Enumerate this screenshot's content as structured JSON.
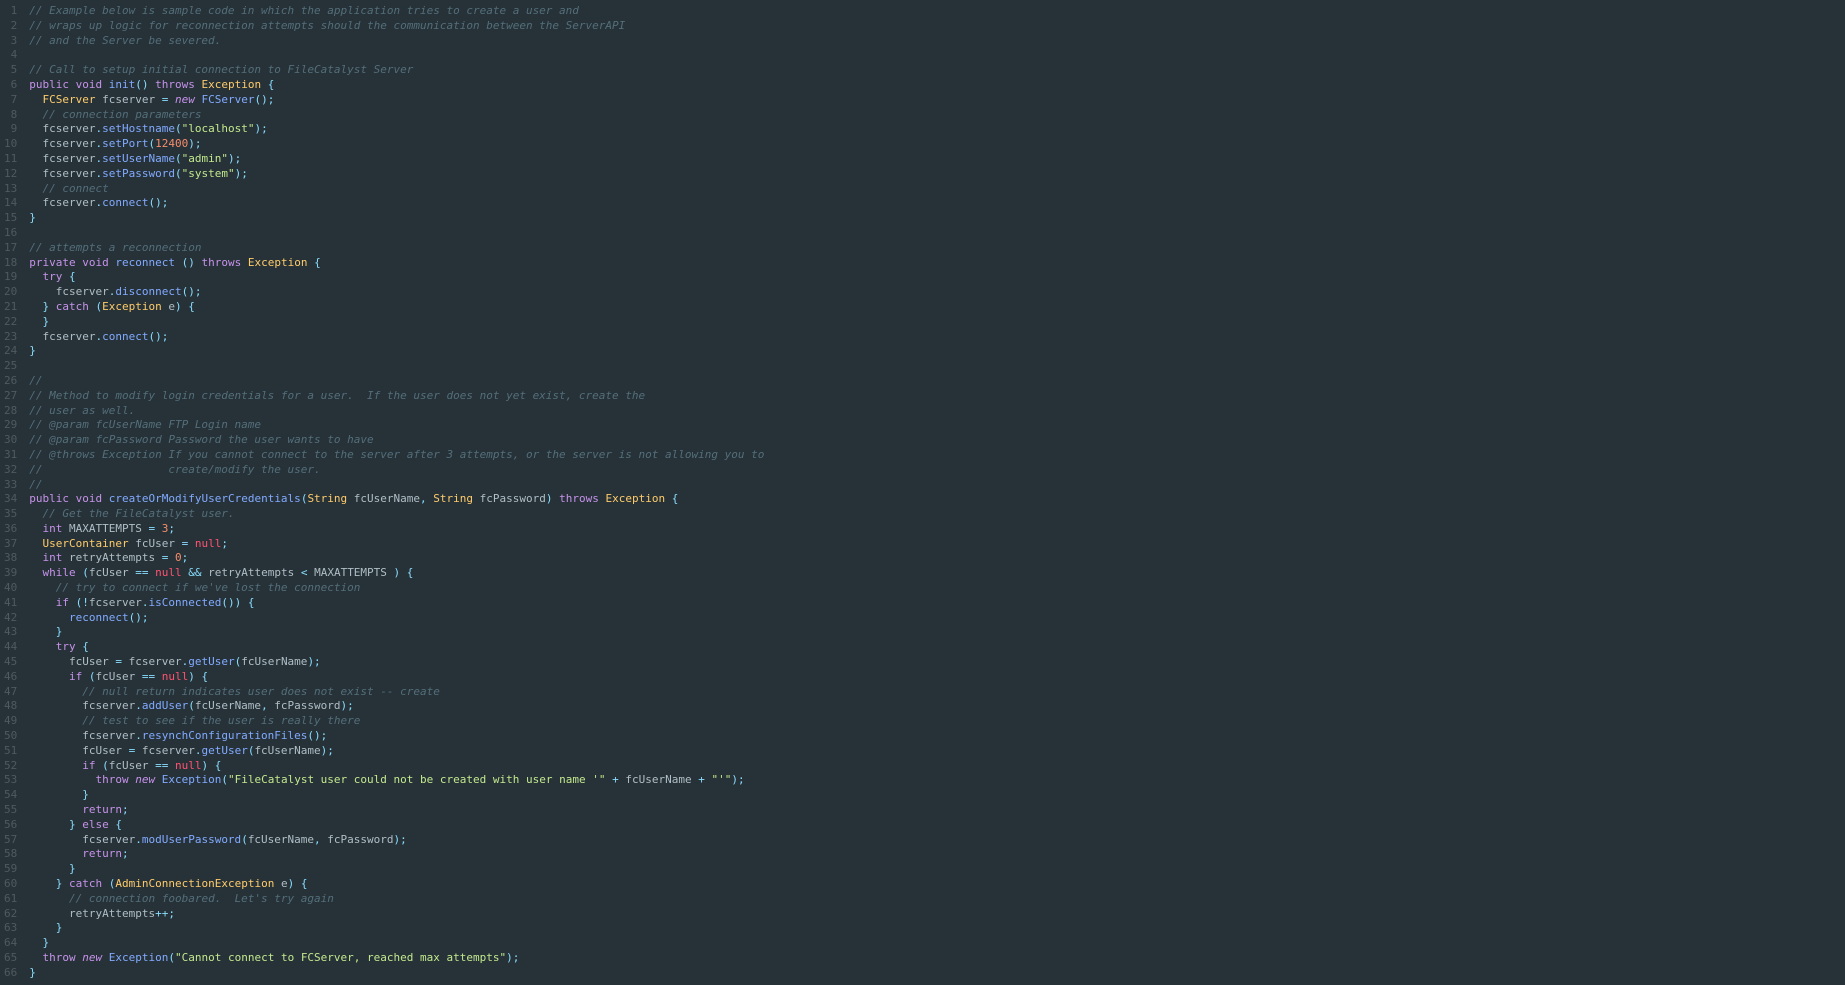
{
  "lines": [
    [
      [
        0,
        "cmt",
        "// Example below is sample code in which the application tries to create a user and "
      ]
    ],
    [
      [
        0,
        "cmt",
        "// wraps up logic for reconnection attempts should the communication between the ServerAPI "
      ]
    ],
    [
      [
        0,
        "cmt",
        "// and the Server be severed."
      ]
    ],
    [
      [
        0,
        "pl",
        ""
      ]
    ],
    [
      [
        0,
        "cmt",
        "// Call to setup initial connection to FileCatalyst Server"
      ]
    ],
    [
      [
        0,
        "kw",
        "public"
      ],
      [
        0,
        "pl",
        " "
      ],
      [
        0,
        "kw",
        "void"
      ],
      [
        0,
        "pl",
        " "
      ],
      [
        0,
        "fn",
        "init"
      ],
      [
        0,
        "op",
        "()"
      ],
      [
        0,
        "pl",
        " "
      ],
      [
        0,
        "kw",
        "throws"
      ],
      [
        0,
        "pl",
        " "
      ],
      [
        0,
        "ty",
        "Exception"
      ],
      [
        0,
        "pl",
        " "
      ],
      [
        0,
        "op",
        "{"
      ]
    ],
    [
      [
        1,
        "ty",
        "FCServer"
      ],
      [
        0,
        "pl",
        " fcserver "
      ],
      [
        0,
        "op",
        "="
      ],
      [
        0,
        "pl",
        " "
      ],
      [
        0,
        "kw2",
        "new"
      ],
      [
        0,
        "pl",
        " "
      ],
      [
        0,
        "fn",
        "FCServer"
      ],
      [
        0,
        "op",
        "();"
      ]
    ],
    [
      [
        1,
        "cmt",
        "// connection parameters"
      ]
    ],
    [
      [
        1,
        "pl",
        "fcserver"
      ],
      [
        0,
        "op",
        "."
      ],
      [
        0,
        "fn",
        "setHostname"
      ],
      [
        0,
        "op",
        "("
      ],
      [
        0,
        "str",
        "\"localhost\""
      ],
      [
        0,
        "op",
        ");"
      ]
    ],
    [
      [
        1,
        "pl",
        "fcserver"
      ],
      [
        0,
        "op",
        "."
      ],
      [
        0,
        "fn",
        "setPort"
      ],
      [
        0,
        "op",
        "("
      ],
      [
        0,
        "num",
        "12400"
      ],
      [
        0,
        "op",
        ");"
      ]
    ],
    [
      [
        1,
        "pl",
        "fcserver"
      ],
      [
        0,
        "op",
        "."
      ],
      [
        0,
        "fn",
        "setUserName"
      ],
      [
        0,
        "op",
        "("
      ],
      [
        0,
        "str",
        "\"admin\""
      ],
      [
        0,
        "op",
        ");"
      ]
    ],
    [
      [
        1,
        "pl",
        "fcserver"
      ],
      [
        0,
        "op",
        "."
      ],
      [
        0,
        "fn",
        "setPassword"
      ],
      [
        0,
        "op",
        "("
      ],
      [
        0,
        "str",
        "\"system\""
      ],
      [
        0,
        "op",
        ");"
      ]
    ],
    [
      [
        1,
        "cmt",
        "// connect"
      ]
    ],
    [
      [
        1,
        "pl",
        "fcserver"
      ],
      [
        0,
        "op",
        "."
      ],
      [
        0,
        "fn",
        "connect"
      ],
      [
        0,
        "op",
        "();"
      ]
    ],
    [
      [
        0,
        "op",
        "}"
      ]
    ],
    [
      [
        0,
        "pl",
        ""
      ]
    ],
    [
      [
        0,
        "cmt",
        "// attempts a reconnection"
      ]
    ],
    [
      [
        0,
        "kw",
        "private"
      ],
      [
        0,
        "pl",
        " "
      ],
      [
        0,
        "kw",
        "void"
      ],
      [
        0,
        "pl",
        " "
      ],
      [
        0,
        "fn",
        "reconnect"
      ],
      [
        0,
        "pl",
        " "
      ],
      [
        0,
        "op",
        "()"
      ],
      [
        0,
        "pl",
        " "
      ],
      [
        0,
        "kw",
        "throws"
      ],
      [
        0,
        "pl",
        " "
      ],
      [
        0,
        "ty",
        "Exception"
      ],
      [
        0,
        "pl",
        " "
      ],
      [
        0,
        "op",
        "{"
      ]
    ],
    [
      [
        1,
        "kw",
        "try"
      ],
      [
        0,
        "pl",
        " "
      ],
      [
        0,
        "op",
        "{"
      ]
    ],
    [
      [
        2,
        "pl",
        "fcserver"
      ],
      [
        0,
        "op",
        "."
      ],
      [
        0,
        "fn",
        "disconnect"
      ],
      [
        0,
        "op",
        "();"
      ]
    ],
    [
      [
        1,
        "op",
        "}"
      ],
      [
        0,
        "pl",
        " "
      ],
      [
        0,
        "kw",
        "catch"
      ],
      [
        0,
        "pl",
        " "
      ],
      [
        0,
        "op",
        "("
      ],
      [
        0,
        "ty",
        "Exception"
      ],
      [
        0,
        "pl",
        " e"
      ],
      [
        0,
        "op",
        ")"
      ],
      [
        0,
        "pl",
        " "
      ],
      [
        0,
        "op",
        "{"
      ]
    ],
    [
      [
        1,
        "op",
        "}"
      ]
    ],
    [
      [
        1,
        "pl",
        "fcserver"
      ],
      [
        0,
        "op",
        "."
      ],
      [
        0,
        "fn",
        "connect"
      ],
      [
        0,
        "op",
        "();"
      ]
    ],
    [
      [
        0,
        "op",
        "}"
      ]
    ],
    [
      [
        0,
        "pl",
        ""
      ]
    ],
    [
      [
        0,
        "cmt",
        "//"
      ]
    ],
    [
      [
        0,
        "cmt",
        "// Method to modify login credentials for a user.  If the user does not yet exist, create the"
      ]
    ],
    [
      [
        0,
        "cmt",
        "// user as well."
      ]
    ],
    [
      [
        0,
        "cmt",
        "// @param fcUserName FTP Login name"
      ]
    ],
    [
      [
        0,
        "cmt",
        "// @param fcPassword Password the user wants to have"
      ]
    ],
    [
      [
        0,
        "cmt",
        "// @throws Exception If you cannot connect to the server after 3 attempts, or the server is not allowing you to"
      ]
    ],
    [
      [
        0,
        "cmt",
        "//                   create/modify the user."
      ]
    ],
    [
      [
        0,
        "cmt",
        "//"
      ]
    ],
    [
      [
        0,
        "kw",
        "public"
      ],
      [
        0,
        "pl",
        " "
      ],
      [
        0,
        "kw",
        "void"
      ],
      [
        0,
        "pl",
        " "
      ],
      [
        0,
        "fn",
        "createOrModifyUserCredentials"
      ],
      [
        0,
        "op",
        "("
      ],
      [
        0,
        "ty",
        "String"
      ],
      [
        0,
        "pl",
        " fcUserName"
      ],
      [
        0,
        "op",
        ","
      ],
      [
        0,
        "pl",
        " "
      ],
      [
        0,
        "ty",
        "String"
      ],
      [
        0,
        "pl",
        " fcPassword"
      ],
      [
        0,
        "op",
        ")"
      ],
      [
        0,
        "pl",
        " "
      ],
      [
        0,
        "kw",
        "throws"
      ],
      [
        0,
        "pl",
        " "
      ],
      [
        0,
        "ty",
        "Exception"
      ],
      [
        0,
        "pl",
        " "
      ],
      [
        0,
        "op",
        "{"
      ]
    ],
    [
      [
        1,
        "cmt",
        "// Get the FileCatalyst user."
      ]
    ],
    [
      [
        1,
        "kw",
        "int"
      ],
      [
        0,
        "pl",
        " MAXATTEMPTS "
      ],
      [
        0,
        "op",
        "="
      ],
      [
        0,
        "pl",
        " "
      ],
      [
        0,
        "num",
        "3"
      ],
      [
        0,
        "op",
        ";"
      ]
    ],
    [
      [
        1,
        "ty",
        "UserContainer"
      ],
      [
        0,
        "pl",
        " fcUser "
      ],
      [
        0,
        "op",
        "="
      ],
      [
        0,
        "pl",
        " "
      ],
      [
        0,
        "bool",
        "null"
      ],
      [
        0,
        "op",
        ";"
      ]
    ],
    [
      [
        1,
        "kw",
        "int"
      ],
      [
        0,
        "pl",
        " retryAttempts "
      ],
      [
        0,
        "op",
        "="
      ],
      [
        0,
        "pl",
        " "
      ],
      [
        0,
        "num",
        "0"
      ],
      [
        0,
        "op",
        ";"
      ]
    ],
    [
      [
        1,
        "kw",
        "while"
      ],
      [
        0,
        "pl",
        " "
      ],
      [
        0,
        "op",
        "("
      ],
      [
        0,
        "pl",
        "fcUser "
      ],
      [
        0,
        "op",
        "=="
      ],
      [
        0,
        "pl",
        " "
      ],
      [
        0,
        "bool",
        "null"
      ],
      [
        0,
        "pl",
        " "
      ],
      [
        0,
        "op",
        "&&"
      ],
      [
        0,
        "pl",
        " retryAttempts "
      ],
      [
        0,
        "op",
        "<"
      ],
      [
        0,
        "pl",
        " MAXATTEMPTS "
      ],
      [
        0,
        "op",
        ")"
      ],
      [
        0,
        "pl",
        " "
      ],
      [
        0,
        "op",
        "{"
      ]
    ],
    [
      [
        2,
        "cmt",
        "// try to connect if we've lost the connection"
      ]
    ],
    [
      [
        2,
        "kw",
        "if"
      ],
      [
        0,
        "pl",
        " "
      ],
      [
        0,
        "op",
        "(!"
      ],
      [
        0,
        "pl",
        "fcserver"
      ],
      [
        0,
        "op",
        "."
      ],
      [
        0,
        "fn",
        "isConnected"
      ],
      [
        0,
        "op",
        "())"
      ],
      [
        0,
        "pl",
        " "
      ],
      [
        0,
        "op",
        "{"
      ]
    ],
    [
      [
        3,
        "fn",
        "reconnect"
      ],
      [
        0,
        "op",
        "();"
      ]
    ],
    [
      [
        2,
        "op",
        "}"
      ]
    ],
    [
      [
        2,
        "kw",
        "try"
      ],
      [
        0,
        "pl",
        " "
      ],
      [
        0,
        "op",
        "{"
      ]
    ],
    [
      [
        3,
        "pl",
        "fcUser "
      ],
      [
        0,
        "op",
        "="
      ],
      [
        0,
        "pl",
        " fcserver"
      ],
      [
        0,
        "op",
        "."
      ],
      [
        0,
        "fn",
        "getUser"
      ],
      [
        0,
        "op",
        "("
      ],
      [
        0,
        "pl",
        "fcUserName"
      ],
      [
        0,
        "op",
        ");"
      ]
    ],
    [
      [
        3,
        "kw",
        "if"
      ],
      [
        0,
        "pl",
        " "
      ],
      [
        0,
        "op",
        "("
      ],
      [
        0,
        "pl",
        "fcUser "
      ],
      [
        0,
        "op",
        "=="
      ],
      [
        0,
        "pl",
        " "
      ],
      [
        0,
        "bool",
        "null"
      ],
      [
        0,
        "op",
        ")"
      ],
      [
        0,
        "pl",
        " "
      ],
      [
        0,
        "op",
        "{"
      ]
    ],
    [
      [
        4,
        "cmt",
        "// null return indicates user does not exist -- create"
      ]
    ],
    [
      [
        4,
        "pl",
        "fcserver"
      ],
      [
        0,
        "op",
        "."
      ],
      [
        0,
        "fn",
        "addUser"
      ],
      [
        0,
        "op",
        "("
      ],
      [
        0,
        "pl",
        "fcUserName"
      ],
      [
        0,
        "op",
        ","
      ],
      [
        0,
        "pl",
        " fcPassword"
      ],
      [
        0,
        "op",
        ");"
      ]
    ],
    [
      [
        4,
        "cmt",
        "// test to see if the user is really there"
      ]
    ],
    [
      [
        4,
        "pl",
        "fcserver"
      ],
      [
        0,
        "op",
        "."
      ],
      [
        0,
        "fn",
        "resynchConfigurationFiles"
      ],
      [
        0,
        "op",
        "();"
      ]
    ],
    [
      [
        4,
        "pl",
        "fcUser "
      ],
      [
        0,
        "op",
        "="
      ],
      [
        0,
        "pl",
        " fcserver"
      ],
      [
        0,
        "op",
        "."
      ],
      [
        0,
        "fn",
        "getUser"
      ],
      [
        0,
        "op",
        "("
      ],
      [
        0,
        "pl",
        "fcUserName"
      ],
      [
        0,
        "op",
        ");"
      ]
    ],
    [
      [
        4,
        "kw",
        "if"
      ],
      [
        0,
        "pl",
        " "
      ],
      [
        0,
        "op",
        "("
      ],
      [
        0,
        "pl",
        "fcUser "
      ],
      [
        0,
        "op",
        "=="
      ],
      [
        0,
        "pl",
        " "
      ],
      [
        0,
        "bool",
        "null"
      ],
      [
        0,
        "op",
        ")"
      ],
      [
        0,
        "pl",
        " "
      ],
      [
        0,
        "op",
        "{"
      ]
    ],
    [
      [
        5,
        "kw",
        "throw"
      ],
      [
        0,
        "pl",
        " "
      ],
      [
        0,
        "kw2",
        "new"
      ],
      [
        0,
        "pl",
        " "
      ],
      [
        0,
        "fn",
        "Exception"
      ],
      [
        0,
        "op",
        "("
      ],
      [
        0,
        "str",
        "\"FileCatalyst user could not be created with user name '\""
      ],
      [
        0,
        "pl",
        " "
      ],
      [
        0,
        "op",
        "+"
      ],
      [
        0,
        "pl",
        " fcUserName "
      ],
      [
        0,
        "op",
        "+"
      ],
      [
        0,
        "pl",
        " "
      ],
      [
        0,
        "str",
        "\"'\""
      ],
      [
        0,
        "op",
        ");"
      ]
    ],
    [
      [
        4,
        "op",
        "}"
      ]
    ],
    [
      [
        4,
        "kw",
        "return"
      ],
      [
        0,
        "op",
        ";"
      ]
    ],
    [
      [
        3,
        "op",
        "}"
      ],
      [
        0,
        "pl",
        " "
      ],
      [
        0,
        "kw",
        "else"
      ],
      [
        0,
        "pl",
        " "
      ],
      [
        0,
        "op",
        "{"
      ]
    ],
    [
      [
        4,
        "pl",
        "fcserver"
      ],
      [
        0,
        "op",
        "."
      ],
      [
        0,
        "fn",
        "modUserPassword"
      ],
      [
        0,
        "op",
        "("
      ],
      [
        0,
        "pl",
        "fcUserName"
      ],
      [
        0,
        "op",
        ","
      ],
      [
        0,
        "pl",
        " fcPassword"
      ],
      [
        0,
        "op",
        ");"
      ]
    ],
    [
      [
        4,
        "kw",
        "return"
      ],
      [
        0,
        "op",
        ";"
      ]
    ],
    [
      [
        3,
        "op",
        "}"
      ]
    ],
    [
      [
        2,
        "op",
        "}"
      ],
      [
        0,
        "pl",
        " "
      ],
      [
        0,
        "kw",
        "catch"
      ],
      [
        0,
        "pl",
        " "
      ],
      [
        0,
        "op",
        "("
      ],
      [
        0,
        "ty",
        "AdminConnectionException"
      ],
      [
        0,
        "pl",
        " e"
      ],
      [
        0,
        "op",
        ")"
      ],
      [
        0,
        "pl",
        " "
      ],
      [
        0,
        "op",
        "{"
      ]
    ],
    [
      [
        3,
        "cmt",
        "// connection foobared.  Let's try again"
      ]
    ],
    [
      [
        3,
        "pl",
        "retryAttempts"
      ],
      [
        0,
        "op",
        "++;"
      ]
    ],
    [
      [
        2,
        "op",
        "}"
      ]
    ],
    [
      [
        1,
        "op",
        "}"
      ]
    ],
    [
      [
        1,
        "kw",
        "throw"
      ],
      [
        0,
        "pl",
        " "
      ],
      [
        0,
        "kw2",
        "new"
      ],
      [
        0,
        "pl",
        " "
      ],
      [
        0,
        "fn",
        "Exception"
      ],
      [
        0,
        "op",
        "("
      ],
      [
        0,
        "str",
        "\"Cannot connect to FCServer, reached max attempts\""
      ],
      [
        0,
        "op",
        ");"
      ]
    ],
    [
      [
        0,
        "op",
        "}"
      ]
    ]
  ],
  "indent_unit": "  "
}
